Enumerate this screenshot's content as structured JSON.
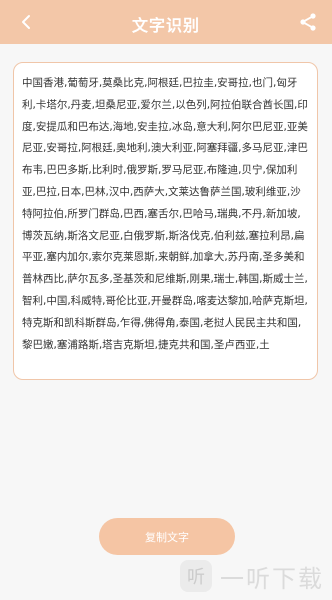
{
  "header": {
    "title": "文字识别",
    "back_icon": "back-chevron-icon",
    "share_icon": "share-icon"
  },
  "result": {
    "text": "中国香港,葡萄牙,莫桑比克,阿根廷,巴拉圭,安哥拉,也门,匈牙利,卡塔尔,丹麦,坦桑尼亚,爱尔兰,以色列,阿拉伯联合酋长国,印度,安提瓜和巴布达,海地,安圭拉,冰岛,意大利,阿尔巴尼亚,亚美尼亚,安哥拉,阿根廷,奥地利,澳大利亚,阿塞拜疆,多马尼亚,津巴布韦,巴巴多斯,比利时,俄罗斯,罗马尼亚,布隆迪,贝宁,保加利亚,巴拉,日本,巴林,汉中,西萨大,文莱达鲁萨兰国,玻利维亚,沙特阿拉伯,所罗门群岛,巴西,塞舌尔,巴哈马,瑞典,不丹,新加坡,博茨瓦纳,斯洛文尼亚,白俄罗斯,斯洛伐克,伯利兹,塞拉利昂,扁平亚,塞内加尔,索尔克莱恩斯,来朝鲜,加拿大,苏丹南,圣多美和普林西比,萨尔瓦多,圣基茨和尼维斯,刚果,瑞士,韩国,斯威士兰,智利,中国,科威特,哥伦比亚,开曼群岛,喀麦达黎加,哈萨克斯坦,特克斯和凯科斯群岛,乍得,佛得角,泰国,老挝人民民主共和国,黎巴嫩,塞浦路斯,塔吉克斯坦,捷克共和国,圣卢西亚,土"
  },
  "actions": {
    "copy_label": "复制文字"
  },
  "watermark": {
    "text": "一听下载",
    "logo_glyph": "听"
  }
}
